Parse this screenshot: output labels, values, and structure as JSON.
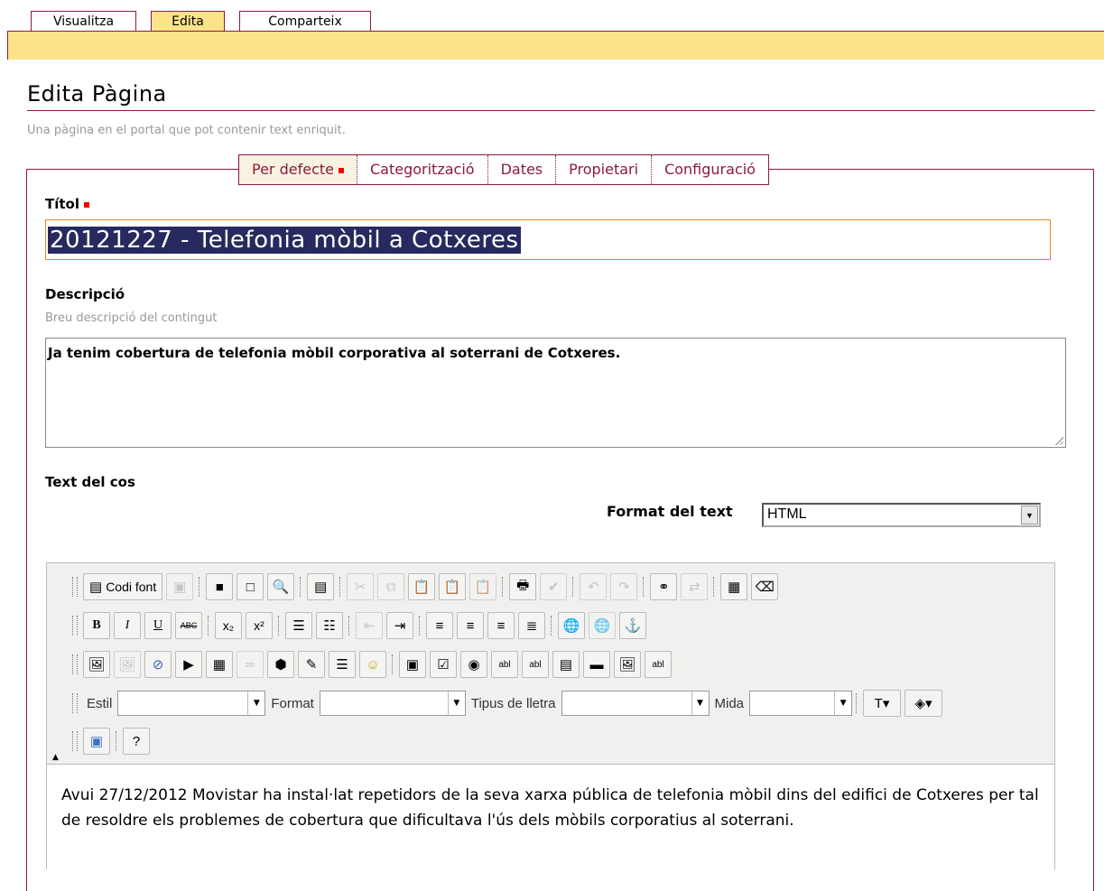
{
  "top_tabs": [
    {
      "label": "Visualitza",
      "active": false
    },
    {
      "label": "Edita",
      "active": true
    },
    {
      "label": "Comparteix",
      "active": false
    }
  ],
  "page": {
    "title": "Edita Pàgina",
    "subtitle": "Una pàgina en el portal que pot contenir text enriquit."
  },
  "sub_tabs": [
    "Per defecte",
    "Categorització",
    "Dates",
    "Propietari",
    "Configuració"
  ],
  "fields": {
    "title": {
      "label": "Títol",
      "value": "20121227 - Telefonia mòbil a Cotxeres"
    },
    "description": {
      "label": "Descripció",
      "help": "Breu descripció del contingut",
      "value": "Ja tenim cobertura de telefonia mòbil corporativa al soterrani de Cotxeres."
    },
    "body": {
      "label": "Text del cos",
      "format_label": "Format del text",
      "format_value": "HTML"
    }
  },
  "editor": {
    "source_button": "Codi font",
    "combos": {
      "style": "Estil",
      "format": "Format",
      "font": "Tipus de lletra",
      "size": "Mida"
    },
    "content": "Avui 27/12/2012 Movistar ha instal·lat repetidors de la seva xarxa pública de telefonia mòbil dins del edifici de Cotxeres per tal de resoldre els problemes de cobertura que dificultava l'ús dels mòbils corporatius al soterrani."
  },
  "colors": {
    "accent": "#8b1a3e",
    "tab_bar": "#fce38a",
    "selection": "#272a5e",
    "focus": "#e98a1c"
  }
}
